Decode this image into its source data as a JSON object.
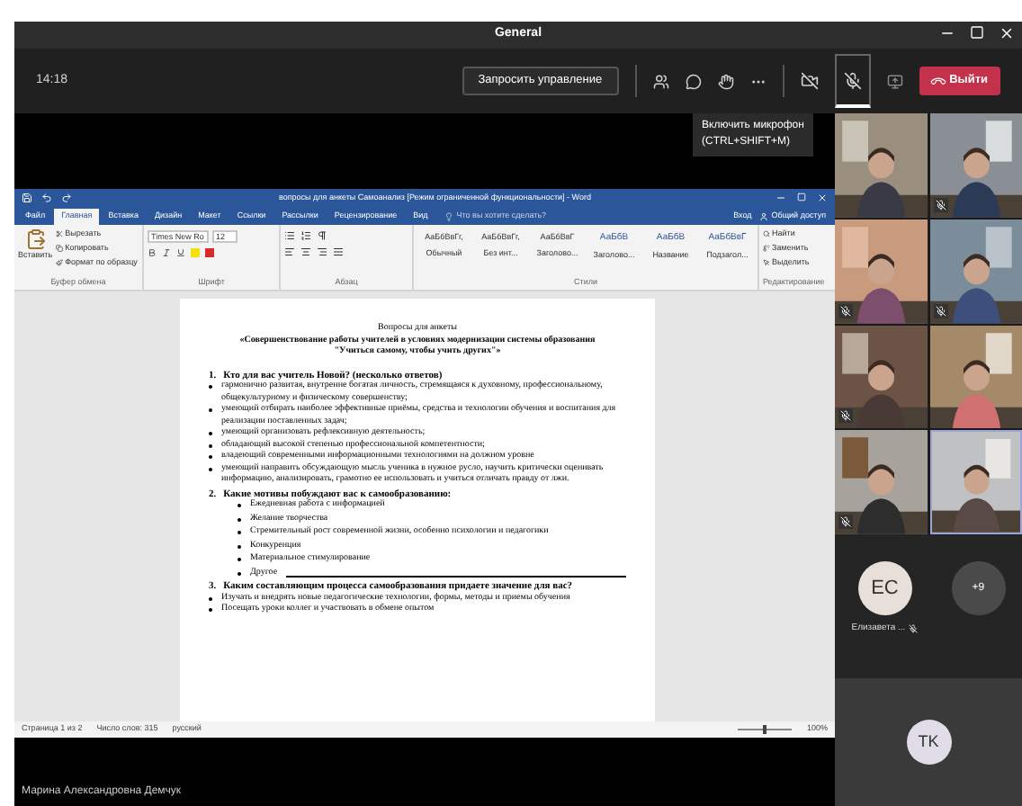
{
  "window": {
    "title": "General"
  },
  "toolbar": {
    "time": "14:18",
    "request_control": "Запросить управление",
    "leave": "Выйти",
    "mic_hovered": true
  },
  "tooltip": {
    "title": "Включить микрофон",
    "shortcut": "(CTRL+SHIFT+M)"
  },
  "word": {
    "title": "вопросы для анкеты Самоанализ [Режим ограниченной функциональности] - Word",
    "tabs": [
      {
        "label": "Файл",
        "selected": false
      },
      {
        "label": "Главная",
        "selected": true
      },
      {
        "label": "Вставка",
        "selected": false
      },
      {
        "label": "Дизайн",
        "selected": false
      },
      {
        "label": "Макет",
        "selected": false
      },
      {
        "label": "Ссылки",
        "selected": false
      },
      {
        "label": "Рассылки",
        "selected": false
      },
      {
        "label": "Рецензирование",
        "selected": false
      },
      {
        "label": "Вид",
        "selected": false
      }
    ],
    "search": {
      "placeholder": "Что вы хотите сделать?"
    },
    "account": {
      "sign_in": "Вход",
      "share": "Общий доступ"
    },
    "clipboard": {
      "paste": "Вставить",
      "items": [
        "Вырезать",
        "Копировать",
        "Формат по образцу"
      ],
      "label": "Буфер обмена"
    },
    "font": {
      "family": "Times New Ro",
      "size": "12",
      "label": "Шрифт"
    },
    "paragraph": {
      "label": "Абзац"
    },
    "styles": {
      "label": "Стили",
      "items": [
        {
          "sample": "АаБбВвГг,",
          "name": "Обычный"
        },
        {
          "sample": "АаБбВвГг,",
          "name": "Без инт..."
        },
        {
          "sample": "АаБбВвГ",
          "name": "Заголово..."
        },
        {
          "sample": "АаБбВ",
          "name": "Заголово..."
        },
        {
          "sample": "АаБбВ",
          "name": "Название"
        },
        {
          "sample": "АаБбВвГ",
          "name": "Подзагол..."
        }
      ]
    },
    "editing": {
      "items": [
        "Найти",
        "Заменить",
        "Выделить"
      ],
      "label": "Редактирование"
    },
    "document": {
      "heading": [
        "Вопросы для анкеты",
        "«Совершенствование работы учителей в условиях модернизации системы образования",
        "\"Учиться самому, чтобы учить других\"»"
      ],
      "items": [
        {
          "kind": "numbered",
          "number": "1.",
          "text": "Кто для вас учитель Новой? (несколько ответов)"
        },
        {
          "kind": "bullet",
          "text": "гармонично развитая, внутренне богатая личность, стремящаяся к духовному, профессиональному, общекультурному и физическому совершенству;"
        },
        {
          "kind": "bullet",
          "text": "умеющий отбирать наиболее эффективные приёмы, средства и технологии обучения и воспитания для реализации поставленных задач;"
        },
        {
          "kind": "bullet",
          "text": "умеющий организовать рефлексивную деятельность;"
        },
        {
          "kind": "bullet",
          "text": "обладающий высокой степенью профессиональной компетентности;"
        },
        {
          "kind": "bullet",
          "text": "владеющий современными информационными технологиями на должном уровне"
        },
        {
          "kind": "bullet",
          "text": "умеющий направить обсуждающую мысль ученика в нужное русло, научить критически оценивать информацию, анализировать, грамотно ее использовать и учиться отличать правду от лжи."
        },
        {
          "kind": "numbered",
          "number": "2.",
          "text": "Какие мотивы побуждают вас к самообразованию:"
        },
        {
          "kind": "subbullet",
          "text": "Ежедневная работа с информацией"
        },
        {
          "kind": "subbullet",
          "text": "Желание творчества"
        },
        {
          "kind": "subbullet",
          "text": "Стремительный рост современной жизни, особенно психологии и педагогики"
        },
        {
          "kind": "subbullet",
          "text": "Конкуренция"
        },
        {
          "kind": "subbullet",
          "text": "Материальное стимулирование"
        },
        {
          "kind": "subbullet_line",
          "text": "Другое"
        },
        {
          "kind": "numbered",
          "number": "3.",
          "text": "Каким составляющим процесса самообразования придаете значение для вас?"
        },
        {
          "kind": "bullet",
          "text": "Изучать и внедрять новые педагогические технологии, формы, методы и приемы обучения"
        },
        {
          "kind": "bullet",
          "text": "Посещать уроки коллег и участвовать в обмене опытом"
        }
      ]
    },
    "status": {
      "page": "Страница 1 из 2",
      "words": "Число слов: 315",
      "language": "русский",
      "zoom": "100%",
      "zoom_slider": {
        "level": 0.5
      }
    }
  },
  "participants": {
    "tiles": [
      {
        "muted": false
      },
      {
        "muted": true
      },
      {
        "muted": true
      },
      {
        "muted": true
      },
      {
        "muted": true
      },
      {
        "muted": false
      },
      {
        "muted": true
      },
      {
        "muted": false
      }
    ],
    "avatars": [
      {
        "kind": "person",
        "initials": "EC",
        "name": "Елизавета ...",
        "muted": true
      },
      {
        "kind": "more",
        "initials": "+9"
      }
    ],
    "self": {
      "initials": "TK"
    }
  },
  "presenter": "Марина Александровна Демчук"
}
